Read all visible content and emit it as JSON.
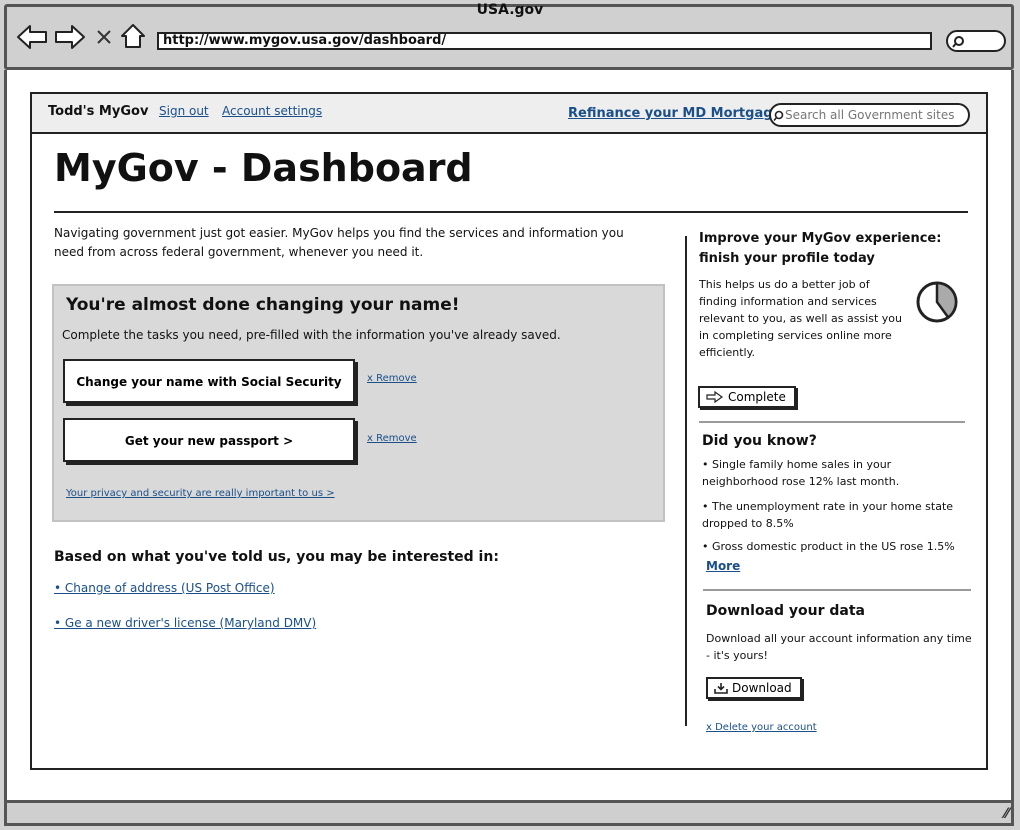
{
  "browser": {
    "window_title": "USA.gov",
    "url": "http://www.mygov.usa.gov/dashboard/"
  },
  "topbar": {
    "brand": "Todd's MyGov",
    "sign_out": "Sign out",
    "account_settings": "Account settings",
    "promo": "Refinance your MD Mortgage",
    "search_placeholder": "Search all Government sites"
  },
  "main": {
    "title": "MyGov - Dashboard",
    "intro": "Navigating government just got easier. MyGov helps you find the services and information you need from across federal government, whenever you need it.",
    "name_change": {
      "heading": "You're almost done changing your name!",
      "subtitle": "Complete the tasks you need, pre-filled with the information you've already saved.",
      "tasks": [
        {
          "label": "Change your name with Social Security >",
          "remove": "x Remove"
        },
        {
          "label": "Get your new passport >",
          "remove": "x Remove"
        }
      ],
      "privacy_link": "Your privacy and security are really important to us >"
    },
    "interests": {
      "heading": "Based on what you've told us, you may be interested in:",
      "items": [
        "• Change of address (US Post Office)",
        "• Ge a new driver's license (Maryland DMV)"
      ]
    }
  },
  "sidebar": {
    "profile": {
      "heading_line1": "Improve your MyGov experience:",
      "heading_line2": "finish your profile today",
      "text": "This helps us do a better job of finding information and services relevant to you, as well as assist you in completing services online more efficiently.",
      "button": "Complete",
      "progress_fraction": 0.4
    },
    "did_you_know": {
      "heading": "Did you know?",
      "facts": [
        "• Single family home sales in your neighborhood rose 12% last month.",
        "• The unemployment rate in your home state dropped to 8.5%",
        "• Gross domestic product in the US rose 1.5%"
      ],
      "more": "More"
    },
    "download": {
      "heading": "Download your data",
      "text": "Download all your account information any time - it's yours!",
      "button": "Download",
      "delete_link": "x Delete your account"
    }
  },
  "icons": {
    "back": "left-arrow",
    "forward": "right-arrow",
    "stop": "x",
    "home": "house",
    "search": "magnifier",
    "complete": "arrow-right-outline",
    "download": "tray-download"
  }
}
